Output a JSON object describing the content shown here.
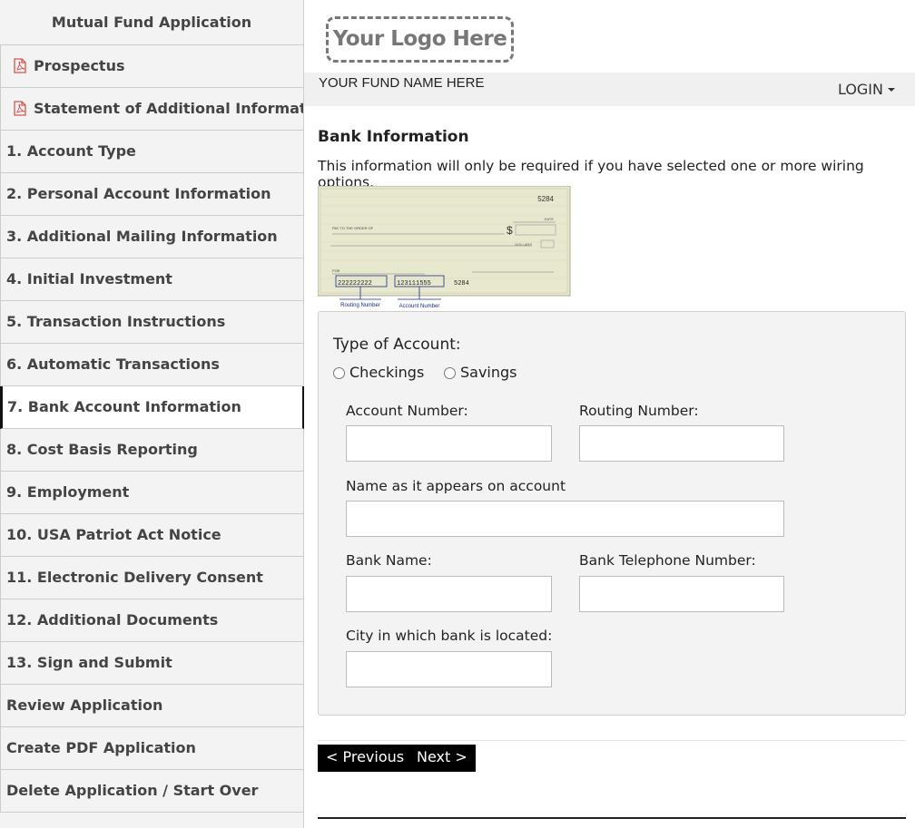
{
  "sidebar": {
    "title": "Mutual Fund Application",
    "documents": [
      {
        "label": "Prospectus"
      },
      {
        "label": "Statement of Additional Information"
      }
    ],
    "steps": [
      {
        "label": "1. Account Type"
      },
      {
        "label": "2. Personal Account Information"
      },
      {
        "label": "3. Additional Mailing Information"
      },
      {
        "label": "4. Initial Investment"
      },
      {
        "label": "5. Transaction Instructions"
      },
      {
        "label": "6. Automatic Transactions"
      },
      {
        "label": "7. Bank Account Information",
        "active": true
      },
      {
        "label": "8. Cost Basis Reporting"
      },
      {
        "label": "9. Employment"
      },
      {
        "label": "10. USA Patriot Act Notice"
      },
      {
        "label": "11. Electronic Delivery Consent"
      },
      {
        "label": "12. Additional Documents"
      },
      {
        "label": "13. Sign and Submit"
      },
      {
        "label": "Review Application"
      },
      {
        "label": "Create PDF Application"
      },
      {
        "label": "Delete Application / Start Over"
      }
    ]
  },
  "header": {
    "logo_text": "Your Logo Here",
    "fund_name": "YOUR FUND NAME HERE",
    "login_label": "LOGIN"
  },
  "section": {
    "title": "Bank Information",
    "note": "This information will only be required if you have selected one or more wiring options."
  },
  "check_image": {
    "check_number": "5284",
    "pay_to_label": "PAY TO THE ORDER OF",
    "currency_symbol": "$",
    "dollars_label": "DOLLARS",
    "date_label": "DATE",
    "for_label": "FOR",
    "routing_digits": "222222222",
    "account_digits": "123111555",
    "check_digits": "5284",
    "routing_caption": "Routing Number",
    "account_caption": "Account Number"
  },
  "form": {
    "type_label": "Type of Account:",
    "options": [
      "Checkings",
      "Savings"
    ],
    "account_number_label": "Account Number:",
    "routing_number_label": "Routing Number:",
    "name_label": "Name as it appears on account",
    "bank_name_label": "Bank Name:",
    "bank_phone_label": "Bank Telephone Number:",
    "city_label": "City in which bank is located:"
  },
  "nav": {
    "previous_label": "< Previous",
    "next_label": "Next >"
  },
  "colors": {
    "pdf_icon": "#d9534f",
    "button_bg": "#000000",
    "panel_bg": "#f3f3f3"
  }
}
